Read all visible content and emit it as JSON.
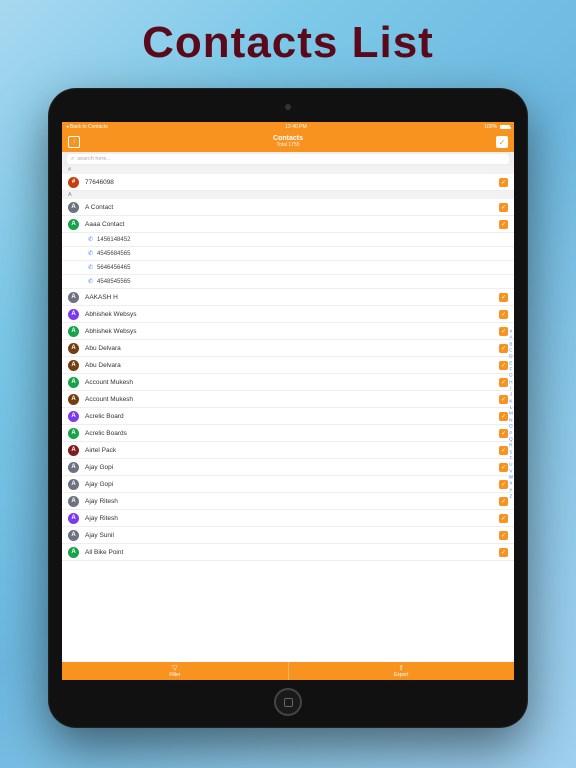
{
  "promo_title": "Contacts List",
  "status": {
    "back": "◂ Back to Contacts",
    "time": "12:40 PM",
    "battery": "100%"
  },
  "nav": {
    "title": "Contacts",
    "subtitle": "Total 1755",
    "left_icon": "↕",
    "right_icon": "✓"
  },
  "search": {
    "placeholder": "search here..."
  },
  "sections": [
    {
      "header": "#",
      "rows": [
        {
          "avatar": "#",
          "color": "#c2410c",
          "name": "77646098",
          "checked": true
        }
      ]
    },
    {
      "header": "A",
      "rows": [
        {
          "avatar": "A",
          "color": "#6b7280",
          "name": "A Contact",
          "checked": true
        },
        {
          "avatar": "A",
          "color": "#16a34a",
          "name": "Aaaa Contact",
          "checked": true,
          "sub": [
            "1456148452",
            "4545684565",
            "5646456465",
            "4548545565"
          ]
        },
        {
          "avatar": "A",
          "color": "#6b7280",
          "name": "AAKASH H",
          "checked": true
        },
        {
          "avatar": "A",
          "color": "#7c3aed",
          "name": "Abhishek Websys",
          "checked": true
        },
        {
          "avatar": "A",
          "color": "#16a34a",
          "name": "Abhishek Websys",
          "checked": true
        },
        {
          "avatar": "A",
          "color": "#713f12",
          "name": "Abu Delvara",
          "checked": true
        },
        {
          "avatar": "A",
          "color": "#713f12",
          "name": "Abu Delvara",
          "checked": true
        },
        {
          "avatar": "A",
          "color": "#16a34a",
          "name": "Account Mukesh",
          "checked": true
        },
        {
          "avatar": "A",
          "color": "#713f12",
          "name": "Account Mukesh",
          "checked": true
        },
        {
          "avatar": "A",
          "color": "#7c3aed",
          "name": "Acrelic Board",
          "checked": true
        },
        {
          "avatar": "A",
          "color": "#16a34a",
          "name": "Acrelic Boards",
          "checked": true
        },
        {
          "avatar": "A",
          "color": "#7f1d1d",
          "name": "Airtel Pack",
          "checked": true
        },
        {
          "avatar": "A",
          "color": "#6b7280",
          "name": "Ajay Gopi",
          "checked": true
        },
        {
          "avatar": "A",
          "color": "#6b7280",
          "name": "Ajay Gopi",
          "checked": true
        },
        {
          "avatar": "A",
          "color": "#6b7280",
          "name": "Ajay Ritesh",
          "checked": true
        },
        {
          "avatar": "A",
          "color": "#7c3aed",
          "name": "Ajay Ritesh",
          "checked": true
        },
        {
          "avatar": "A",
          "color": "#6b7280",
          "name": "Ajay Sunil",
          "checked": true
        },
        {
          "avatar": "A",
          "color": "#16a34a",
          "name": "All Bike Point",
          "checked": true
        }
      ]
    }
  ],
  "index_letters": [
    "#",
    "A",
    "B",
    "C",
    "D",
    "E",
    "F",
    "G",
    "H",
    "I",
    "J",
    "K",
    "L",
    "M",
    "N",
    "O",
    "P",
    "Q",
    "R",
    "S",
    "T",
    "U",
    "V",
    "W",
    "X",
    "Y",
    "Z"
  ],
  "bottombar": {
    "filter": {
      "icon": "▽",
      "label": "Filter"
    },
    "export": {
      "icon": "⇪",
      "label": "Export"
    }
  }
}
